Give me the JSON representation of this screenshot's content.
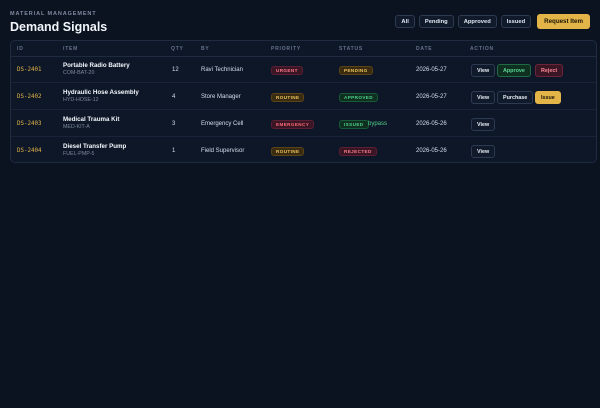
{
  "header": {
    "eyebrow": "MATERIAL MANAGEMENT",
    "title": "Demand Signals"
  },
  "filters": {
    "all": "All",
    "pending": "Pending",
    "approved": "Approved",
    "issued": "Issued",
    "request": "Request Item"
  },
  "table": {
    "columns": {
      "id": "ID",
      "item": "ITEM",
      "qty": "QTY",
      "by": "BY",
      "priority": "PRIORITY",
      "status": "STATUS",
      "date": "DATE",
      "action": "ACTION"
    },
    "rows": [
      {
        "id": "DS-2401",
        "item": "Portable Radio Battery",
        "sku": "COM-BAT-20",
        "qty": "12",
        "by": "Ravi Technician",
        "priority": "URGENT",
        "status": "PENDING",
        "date": "2026-05-27",
        "view": "View",
        "action2": "Approve",
        "action3": "Reject"
      },
      {
        "id": "DS-2402",
        "item": "Hydraulic Hose Assembly",
        "sku": "HYD-HOSE-12",
        "qty": "4",
        "by": "Store Manager",
        "priority": "ROUTINE",
        "status": "APPROVED",
        "date": "2026-05-27",
        "view": "View",
        "action2": "Purchase",
        "action3": "Issue"
      },
      {
        "id": "DS-2403",
        "item": "Medical Trauma Kit",
        "sku": "MED-KIT-A",
        "qty": "3",
        "by": "Emergency Cell",
        "priority": "EMERGENCY",
        "status": "ISSUED",
        "status_note": "bypass",
        "date": "2026-05-26",
        "view": "View"
      },
      {
        "id": "DS-2404",
        "item": "Diesel Transfer Pump",
        "sku": "FUEL-PMP-5",
        "qty": "1",
        "by": "Field Supervisor",
        "priority": "ROUTINE",
        "status": "REJECTED",
        "date": "2026-05-26",
        "view": "View"
      }
    ]
  }
}
